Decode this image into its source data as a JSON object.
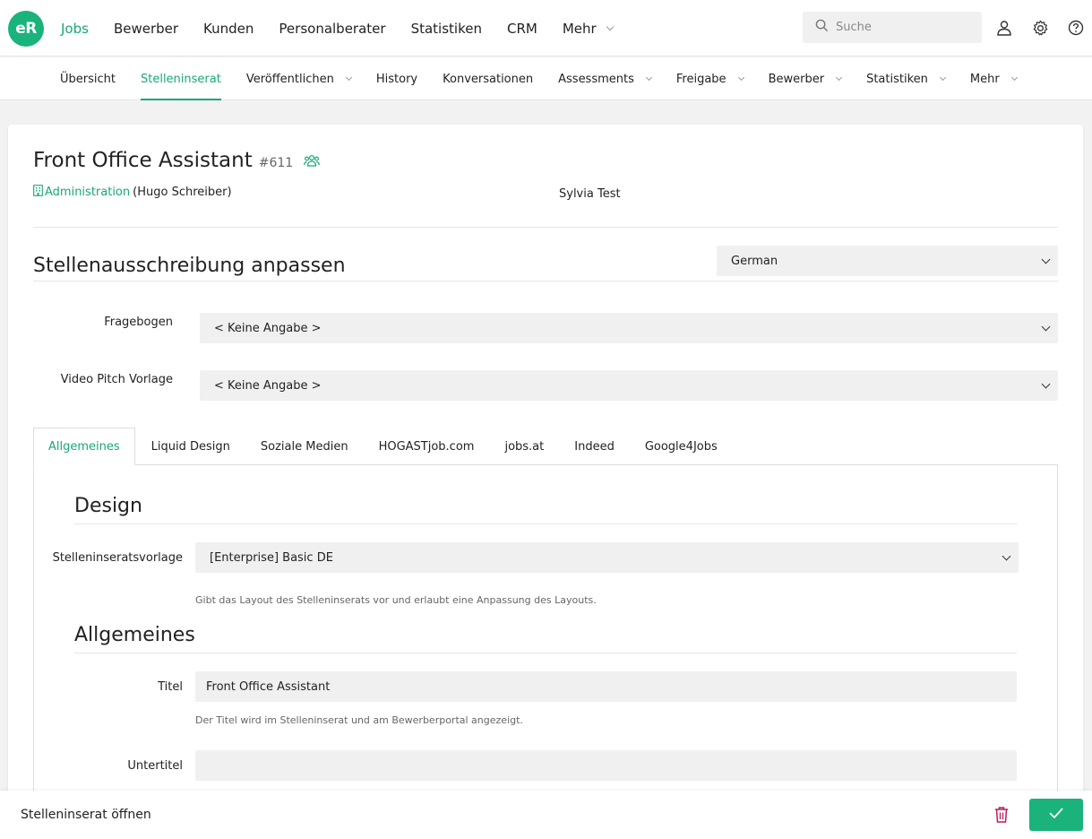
{
  "app": {
    "logo_text": "eR",
    "brand_color": "#19b37b"
  },
  "main_nav": {
    "items": [
      {
        "label": "Jobs",
        "active": true
      },
      {
        "label": "Bewerber"
      },
      {
        "label": "Kunden"
      },
      {
        "label": "Personalberater"
      },
      {
        "label": "Statistiken"
      },
      {
        "label": "CRM"
      },
      {
        "label": "Mehr",
        "dropdown": true
      }
    ],
    "search_placeholder": "Suche"
  },
  "sub_nav": {
    "items": [
      {
        "label": "Übersicht"
      },
      {
        "label": "Stelleninserat",
        "active": true
      },
      {
        "label": "Veröffentlichen",
        "dropdown": true
      },
      {
        "label": "History"
      },
      {
        "label": "Konversationen"
      },
      {
        "label": "Assessments",
        "dropdown": true
      },
      {
        "label": "Freigabe",
        "dropdown": true
      },
      {
        "label": "Bewerber",
        "dropdown": true
      },
      {
        "label": "Statistiken",
        "dropdown": true
      },
      {
        "label": "Mehr",
        "dropdown": true
      }
    ]
  },
  "job": {
    "title": "Front Office Assistant",
    "id": "#611",
    "department": "Administration",
    "department_person": "(Hugo Schreiber)",
    "owner": "Sylvia Test"
  },
  "customize": {
    "title": "Stellenausschreibung anpassen",
    "language": "German",
    "fragebogen_label": "Fragebogen",
    "fragebogen_value": "< Keine Angabe >",
    "video_label": "Video Pitch Vorlage",
    "video_value": "< Keine Angabe >"
  },
  "tabs": [
    {
      "label": "Allgemeines",
      "active": true
    },
    {
      "label": "Liquid Design"
    },
    {
      "label": "Soziale Medien"
    },
    {
      "label": "HOGASTjob.com"
    },
    {
      "label": "jobs.at"
    },
    {
      "label": "Indeed"
    },
    {
      "label": "Google4Jobs"
    }
  ],
  "panel": {
    "design_heading": "Design",
    "template_label": "Stelleninseratsvorlage",
    "template_value": "[Enterprise] Basic DE",
    "template_hint": "Gibt das Layout des Stelleninserats vor und erlaubt eine Anpassung des Layouts.",
    "general_heading": "Allgemeines",
    "title_label": "Titel",
    "title_value": "Front Office Assistant",
    "title_hint": "Der Titel wird im Stelleninserat und am Bewerberportal angezeigt.",
    "subtitle_label": "Untertitel",
    "subtitle_value": ""
  },
  "footer": {
    "label": "Stelleninserat öffnen"
  },
  "colors": {
    "accent": "#19a874",
    "danger": "#c2185b"
  }
}
